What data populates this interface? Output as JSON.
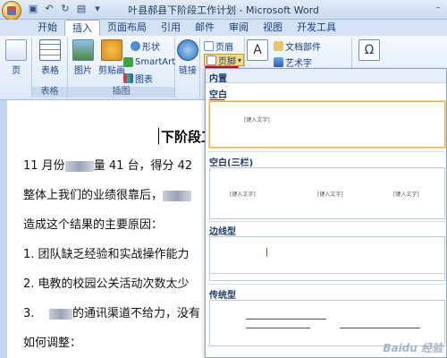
{
  "window": {
    "title": "叶县郝县下阶段工作计划 - Microsoft Word"
  },
  "tabs": [
    "开始",
    "插入",
    "页面布局",
    "引用",
    "邮件",
    "审阅",
    "视图",
    "开发工具"
  ],
  "ribbon": {
    "page_group": {
      "page_btn": "页"
    },
    "table_group": {
      "table_btn": "表格",
      "label": "表格"
    },
    "illus_group": {
      "picture": "图片",
      "clipart": "剪贴画",
      "shapes": "形状",
      "smartart": "SmartArt",
      "chart": "图表",
      "label": "插图"
    },
    "links_group": {
      "link": "链接"
    },
    "hf_group": {
      "header": "页眉",
      "footer": "页脚"
    },
    "text_group": {
      "textbox_a": "A",
      "docparts": "文档部件",
      "wordart": "艺术字",
      "special": "符号"
    }
  },
  "document": {
    "heading": "下阶段工",
    "lines": [
      {
        "pre": "11 月份",
        "post": "量 41 台，得分 42"
      },
      {
        "pre": "整体上我们的业绩很靠后，",
        "post": ""
      },
      {
        "pre": "造成这个结果的主要原因：",
        "post": ""
      },
      {
        "pre": "1. 团队缺乏经验和实战操作能力",
        "post": ""
      },
      {
        "pre": "2. 电教的校园公关活动次数太少",
        "post": ""
      },
      {
        "pre": "3.",
        "post": "的通讯渠道不给力，没有"
      },
      {
        "pre": "如何调整：",
        "post": ""
      }
    ]
  },
  "gallery": {
    "header": "内置",
    "sections": [
      {
        "label": "空白",
        "placeholders": [
          "[键入文字]"
        ]
      },
      {
        "label": "空白(三栏)",
        "placeholders": [
          "[键入文字]",
          "[键入文字]",
          "[键入文字]"
        ]
      },
      {
        "label": "边线型",
        "placeholders": []
      },
      {
        "label": "传统型",
        "placeholders": []
      }
    ],
    "watermark": "Baidu 经验"
  },
  "colors": {
    "accent_red": "#e0000f",
    "ribbon_blue": "#15428b"
  }
}
